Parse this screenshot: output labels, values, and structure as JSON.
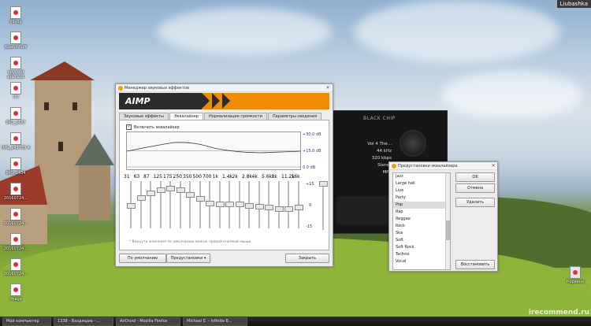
{
  "desktop": {
    "user": "Liubashka",
    "watermark": "irecommend.ru",
    "icons": [
      {
        "label": "ifiledp"
      },
      {
        "label": "Beatchfluff"
      },
      {
        "label": "opyvetd epbrabd"
      },
      {
        "label": "???"
      },
      {
        "label": "IMG_2437"
      },
      {
        "label": "IMG_243753 4"
      },
      {
        "label": "IMG_2434"
      },
      {
        "label": "20160724..."
      },
      {
        "label": "20160724..."
      },
      {
        "label": "20160724..."
      },
      {
        "label": "20160724..."
      },
      {
        "label": "image"
      }
    ],
    "trash_label": "Корзина"
  },
  "taskbar": {
    "items": [
      "Мой компьютер",
      "1338 - Входящие - ...",
      "AirDroid - Mozilla Firefox",
      "Michael E. - Infinite B..."
    ]
  },
  "player": {
    "brand": "BLACK CHIP",
    "track": "Vol 4 The...",
    "bitrate_khz": "44 kHz",
    "kbps": "320 kbps",
    "mode": "Stereo",
    "format": "MP3"
  },
  "dialog": {
    "title": "Менеджер звуковых эффектов",
    "logo": "AIMP",
    "tabs": [
      "Звуковые эффекты",
      "Эквалайзер",
      "Нормализация громкости",
      "Параметры сведения"
    ],
    "active_tab": 1,
    "enable_label": "Включить эквалайзер",
    "db_labels": [
      "+30.0 dB",
      "+15.0 dB",
      "0.0 dB"
    ],
    "bands": [
      {
        "freq": "31",
        "gain": 0.0
      },
      {
        "freq": "63",
        "gain": 0.35
      },
      {
        "freq": "87",
        "gain": 0.55
      },
      {
        "freq": "125",
        "gain": 0.7
      },
      {
        "freq": "175",
        "gain": 0.78
      },
      {
        "freq": "250",
        "gain": 0.7
      },
      {
        "freq": "350",
        "gain": 0.5
      },
      {
        "freq": "500",
        "gain": 0.3
      },
      {
        "freq": "700",
        "gain": 0.1
      },
      {
        "freq": "1k",
        "gain": 0.05
      },
      {
        "freq": "1.4k",
        "gain": 0.05
      },
      {
        "freq": "2k",
        "gain": 0.05
      },
      {
        "freq": "2.8k",
        "gain": 0.0
      },
      {
        "freq": "4k",
        "gain": -0.05
      },
      {
        "freq": "5.6k",
        "gain": -0.1
      },
      {
        "freq": "8k",
        "gain": -0.15
      },
      {
        "freq": "11.2k",
        "gain": -0.15
      },
      {
        "freq": "16k",
        "gain": -0.1
      }
    ],
    "bands_top_labels": [
      "31",
      "87",
      "175",
      "350",
      "700",
      "1.4k",
      "2.8k",
      "5.6k",
      "11.2k"
    ],
    "bands_bottom_labels": [
      "63",
      "125",
      "250",
      "500",
      "1k",
      "2k",
      "4k",
      "8k",
      "16k"
    ],
    "gain_scale": [
      "+15",
      "0",
      "-15"
    ],
    "hint": "* Вернуть значения по умолчанию можно правой кнопкой мыши",
    "buttons": {
      "defaults": "По умолчанию",
      "presets": "Предустановки",
      "close": "Закрыть"
    }
  },
  "presets_window": {
    "title": "Предустановки эквалайзера",
    "items": [
      "Jazz",
      "Large hall",
      "Live",
      "Party",
      "Pop",
      "Rap",
      "Reggae",
      "Rock",
      "Ska",
      "Soft",
      "Soft Rock",
      "Techno",
      "Vocal"
    ],
    "selected": "Pop",
    "buttons": {
      "ok": "OK",
      "cancel": "Отмена",
      "delete": "Удалить",
      "restore": "Восстановить"
    }
  }
}
